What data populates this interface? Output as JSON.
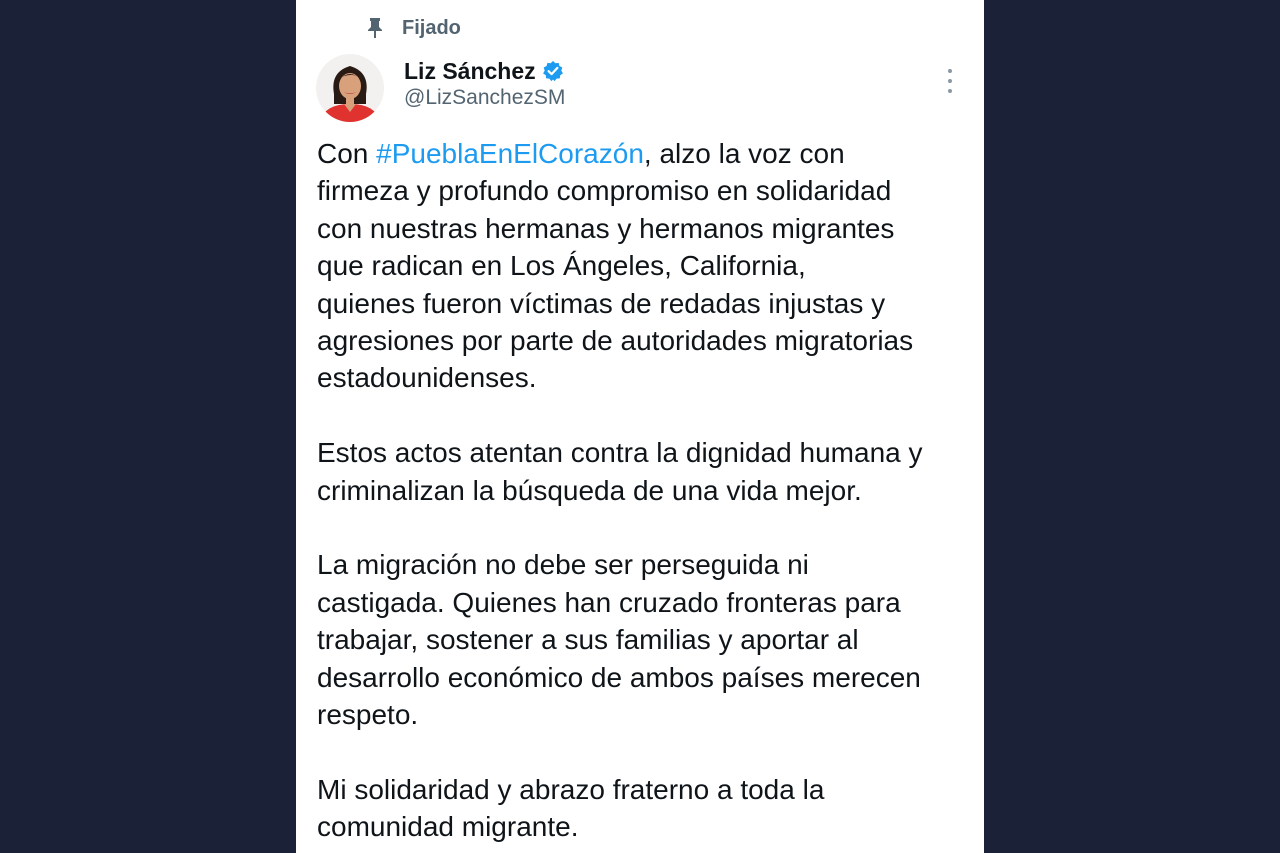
{
  "pinned": {
    "label": "Fijado",
    "icon": "pin-icon"
  },
  "author": {
    "name": "Liz Sánchez",
    "handle": "@LizSanchezSM",
    "verified_icon": "verified-badge-icon",
    "verified_color": "#1d9bf0"
  },
  "menu": {
    "icon": "more-options-icon"
  },
  "tweet": {
    "p1_prefix": "Con ",
    "hashtag": "#PueblaEnElCorazón",
    "p1_l1_rest": ", alzo la voz con",
    "p1_l2": "firmeza y profundo compromiso en solidaridad",
    "p1_l3": "con nuestras hermanas y hermanos migrantes",
    "p1_l4": "que radican en Los Ángeles, California,",
    "p1_l5": "quienes fueron víctimas de redadas injustas y",
    "p1_l6": "agresiones por parte de autoridades migratorias",
    "p1_l7": "estadounidenses.",
    "p2_l1": "Estos actos atentan contra la dignidad humana y",
    "p2_l2": "criminalizan la búsqueda de una vida mejor.",
    "p3_l1": "La migración no debe ser perseguida ni",
    "p3_l2": "castigada. Quienes han cruzado fronteras para",
    "p3_l3": "trabajar, sostener a sus familias y aportar al",
    "p3_l4": "desarrollo económico de ambos países merecen",
    "p3_l5": "respeto.",
    "p4_l1": "Mi solidaridad y abrazo fraterno a toda la",
    "p4_l2": "comunidad migrante."
  },
  "colors": {
    "background": "#1b2238",
    "card": "#ffffff",
    "text": "#0f1419",
    "secondary_text": "#536471",
    "link": "#1d9bf0"
  }
}
